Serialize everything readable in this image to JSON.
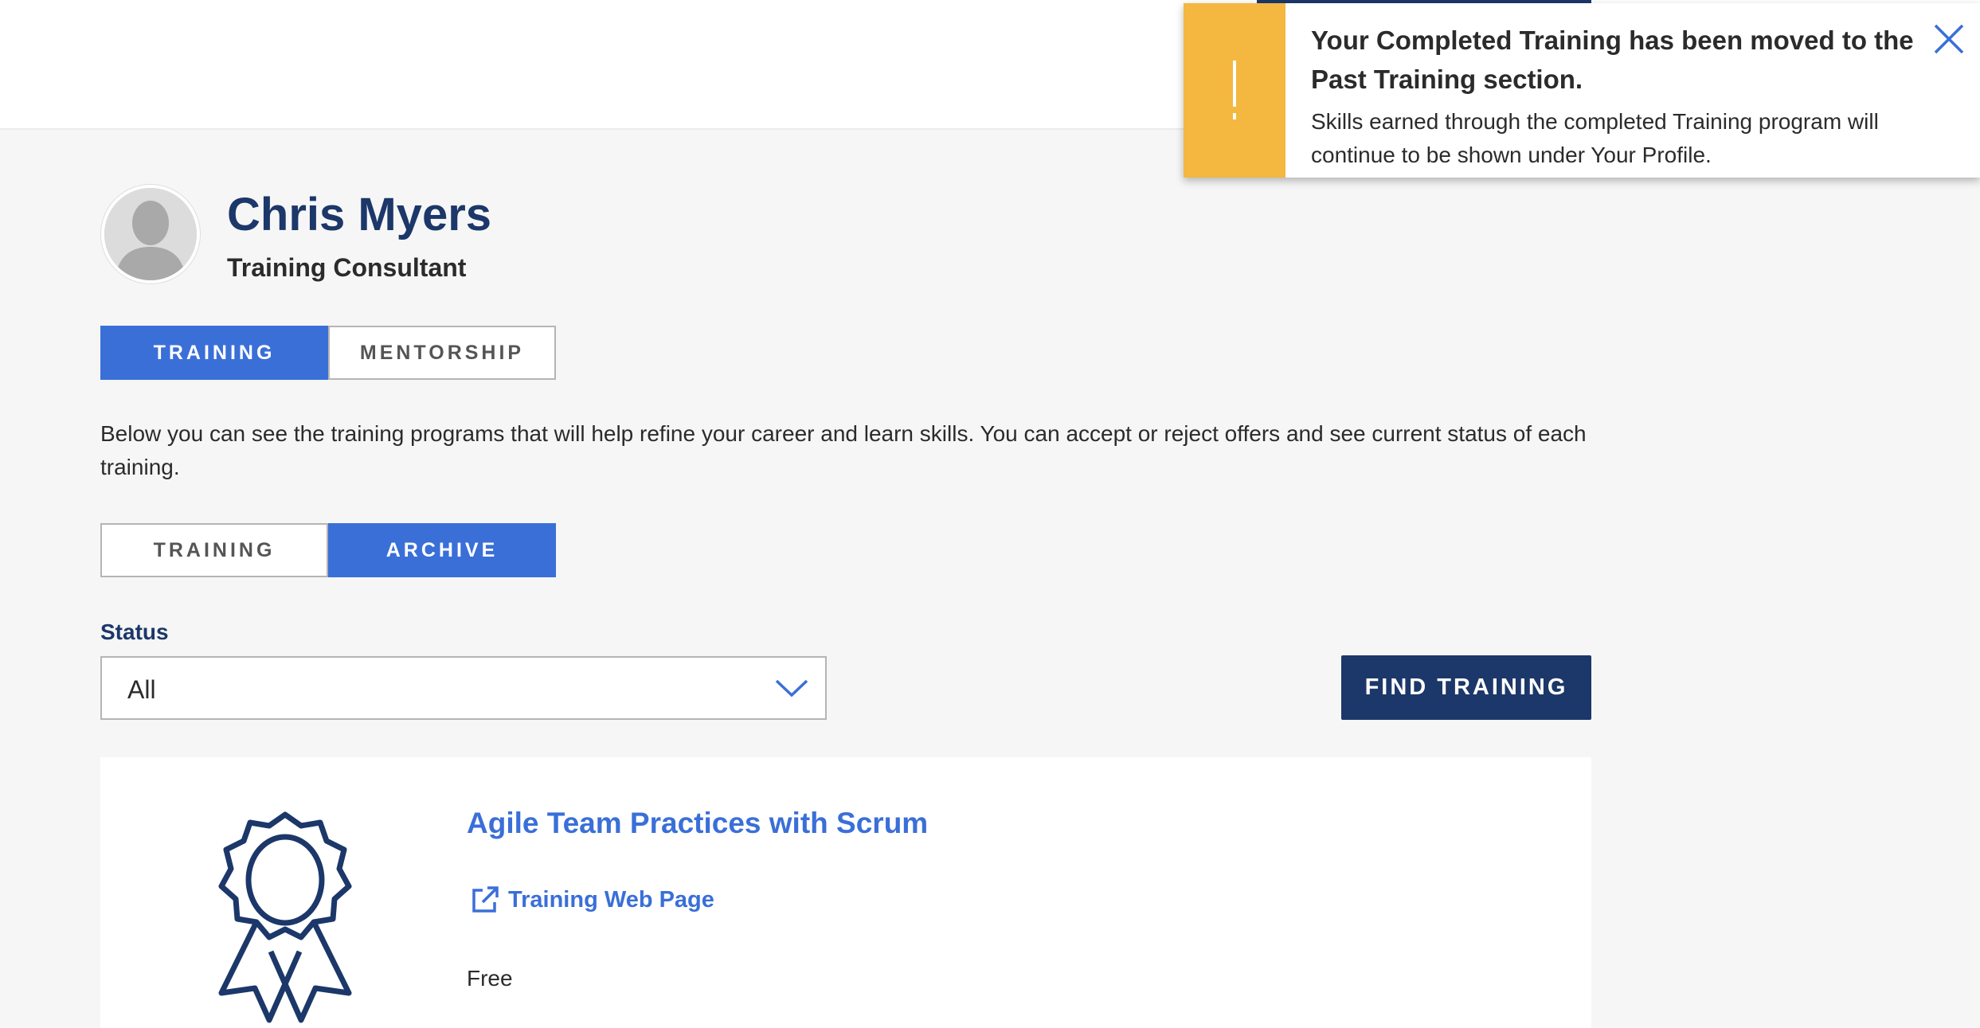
{
  "toast": {
    "title": "Your Completed Training has been moved to the Past Training section.",
    "message": "Skills earned through the completed Training program will continue to be shown under Your Profile.",
    "accent_color": "#f4b740",
    "close_icon": "close-icon"
  },
  "profile": {
    "name": "Chris Myers",
    "role": "Training Consultant",
    "avatar_icon": "user-silhouette-icon"
  },
  "main_tabs": [
    {
      "label": "TRAINING",
      "active": true
    },
    {
      "label": "MENTORSHIP",
      "active": false
    }
  ],
  "intro_text": "Below you can see the training programs that will help refine your career and learn skills. You can accept or reject offers and see current status of each training.",
  "sub_tabs": [
    {
      "label": "TRAINING",
      "active": false
    },
    {
      "label": "ARCHIVE",
      "active": true
    }
  ],
  "filter": {
    "status_label": "Status",
    "status_value": "All"
  },
  "find_button_label": "FIND TRAINING",
  "training_card": {
    "title": "Agile Team Practices with Scrum",
    "link_label": "Training Web Page",
    "price": "Free",
    "icon": "award-ribbon-icon",
    "link_icon": "external-link-icon"
  },
  "colors": {
    "primary_blue": "#3a6fd8",
    "navy": "#1c3769",
    "warning": "#f4b740",
    "background": "#f6f6f6"
  }
}
